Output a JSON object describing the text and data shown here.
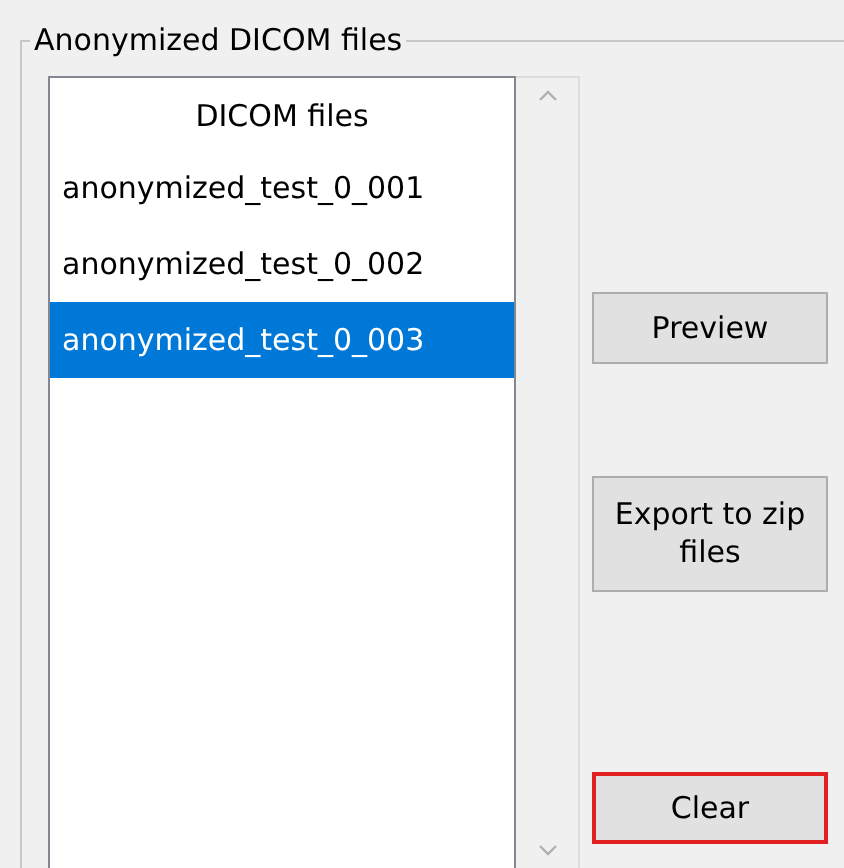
{
  "group": {
    "title": "Anonymized DICOM files"
  },
  "list": {
    "header": "DICOM files",
    "items": [
      {
        "label": "anonymized_test_0_001",
        "selected": false
      },
      {
        "label": "anonymized_test_0_002",
        "selected": false
      },
      {
        "label": "anonymized_test_0_003",
        "selected": true
      }
    ]
  },
  "buttons": [
    {
      "label": "Preview",
      "focused": false
    },
    {
      "label": "Export to zip files",
      "focused": false
    },
    {
      "label": "Clear",
      "focused": true
    }
  ]
}
